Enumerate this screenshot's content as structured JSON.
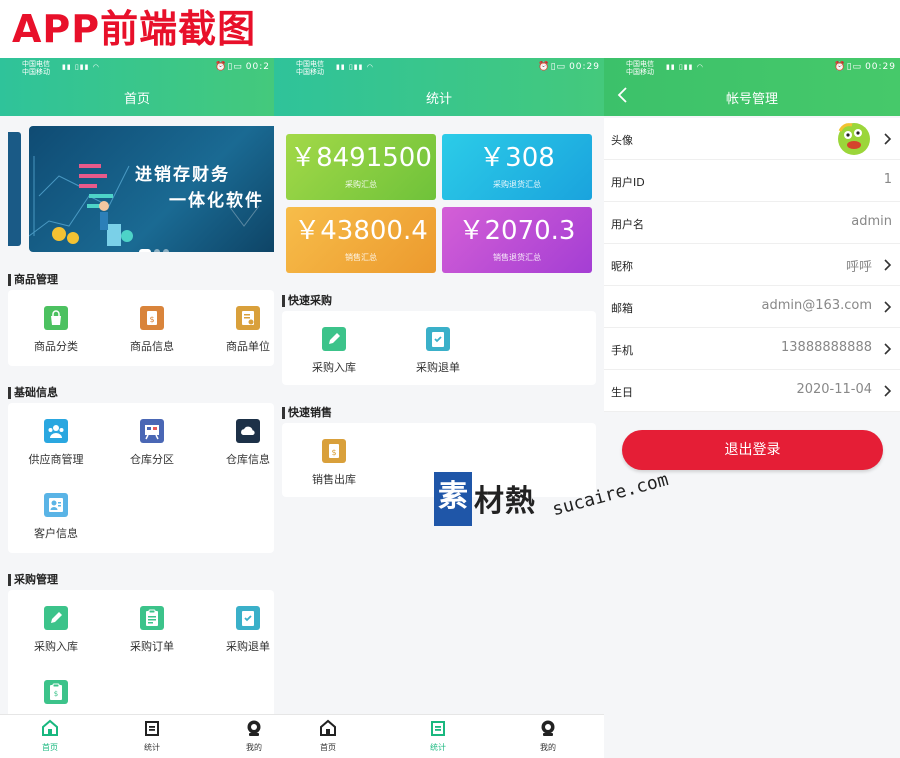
{
  "page_heading": "APP前端截图",
  "colors": {
    "accent": "#2fc39a",
    "logout": "#e51e36",
    "tab_active": "#19b87f"
  },
  "status": {
    "carrier1": "中国电信",
    "carrier2": "中国移动",
    "time_home": "00:2",
    "time_stats": "00:29",
    "time_account": "00:29"
  },
  "home": {
    "title": "首页",
    "banner": {
      "line1": "进销存财务",
      "line2": "一体化软件"
    },
    "sections": [
      {
        "title": "商品管理",
        "items": [
          {
            "label": "商品分类",
            "icon": "bag-icon"
          },
          {
            "label": "商品信息",
            "icon": "price-tag-icon"
          },
          {
            "label": "商品单位",
            "icon": "unit-icon"
          }
        ]
      },
      {
        "title": "基础信息",
        "items": [
          {
            "label": "供应商管理",
            "icon": "supplier-icon"
          },
          {
            "label": "仓库分区",
            "icon": "warehouse-zone-icon"
          },
          {
            "label": "仓库信息",
            "icon": "cloud-icon"
          },
          {
            "label": "客户信息",
            "icon": "customer-icon"
          }
        ]
      },
      {
        "title": "采购管理",
        "items": [
          {
            "label": "采购入库",
            "icon": "pencil-icon"
          },
          {
            "label": "采购订单",
            "icon": "order-icon"
          },
          {
            "label": "采购退单",
            "icon": "return-icon"
          },
          {
            "label": "",
            "icon": "receipt-icon"
          }
        ]
      }
    ]
  },
  "stats": {
    "title": "统计",
    "cards": [
      {
        "value": "￥8491500",
        "label": "采购汇总",
        "color": "#8fd13f"
      },
      {
        "value": "￥308",
        "label": "采购退货汇总",
        "color": "#21b8e2"
      },
      {
        "value": "￥43800.4",
        "label": "销售汇总",
        "color": "#f0a93a"
      },
      {
        "value": "￥2070.3",
        "label": "销售退货汇总",
        "color": "#b64fd6"
      }
    ],
    "quick_purchase": {
      "title": "快速采购",
      "items": [
        {
          "label": "采购入库",
          "icon": "pencil-icon"
        },
        {
          "label": "采购退单",
          "icon": "return-icon"
        }
      ]
    },
    "quick_sales": {
      "title": "快速销售",
      "items": [
        {
          "label": "销售出库",
          "icon": "price-tag-icon"
        }
      ]
    }
  },
  "account": {
    "title": "帐号管理",
    "rows": [
      {
        "label": "头像",
        "value": "",
        "arrow": true
      },
      {
        "label": "用户ID",
        "value": "1",
        "arrow": false
      },
      {
        "label": "用户名",
        "value": "admin",
        "arrow": false
      },
      {
        "label": "昵称",
        "value": "呼呼",
        "arrow": true
      },
      {
        "label": "邮箱",
        "value": "admin@163.com",
        "arrow": true
      },
      {
        "label": "手机",
        "value": "13888888888",
        "arrow": true
      },
      {
        "label": "生日",
        "value": "2020-11-04",
        "arrow": true
      }
    ],
    "logout": "退出登录"
  },
  "tabs": [
    {
      "label": "首页",
      "icon": "home-icon"
    },
    {
      "label": "统计",
      "icon": "stats-icon"
    },
    {
      "label": "我的",
      "icon": "profile-icon"
    }
  ],
  "watermark": {
    "box": "素",
    "text": "材熱",
    "url": "sucaire.com"
  }
}
